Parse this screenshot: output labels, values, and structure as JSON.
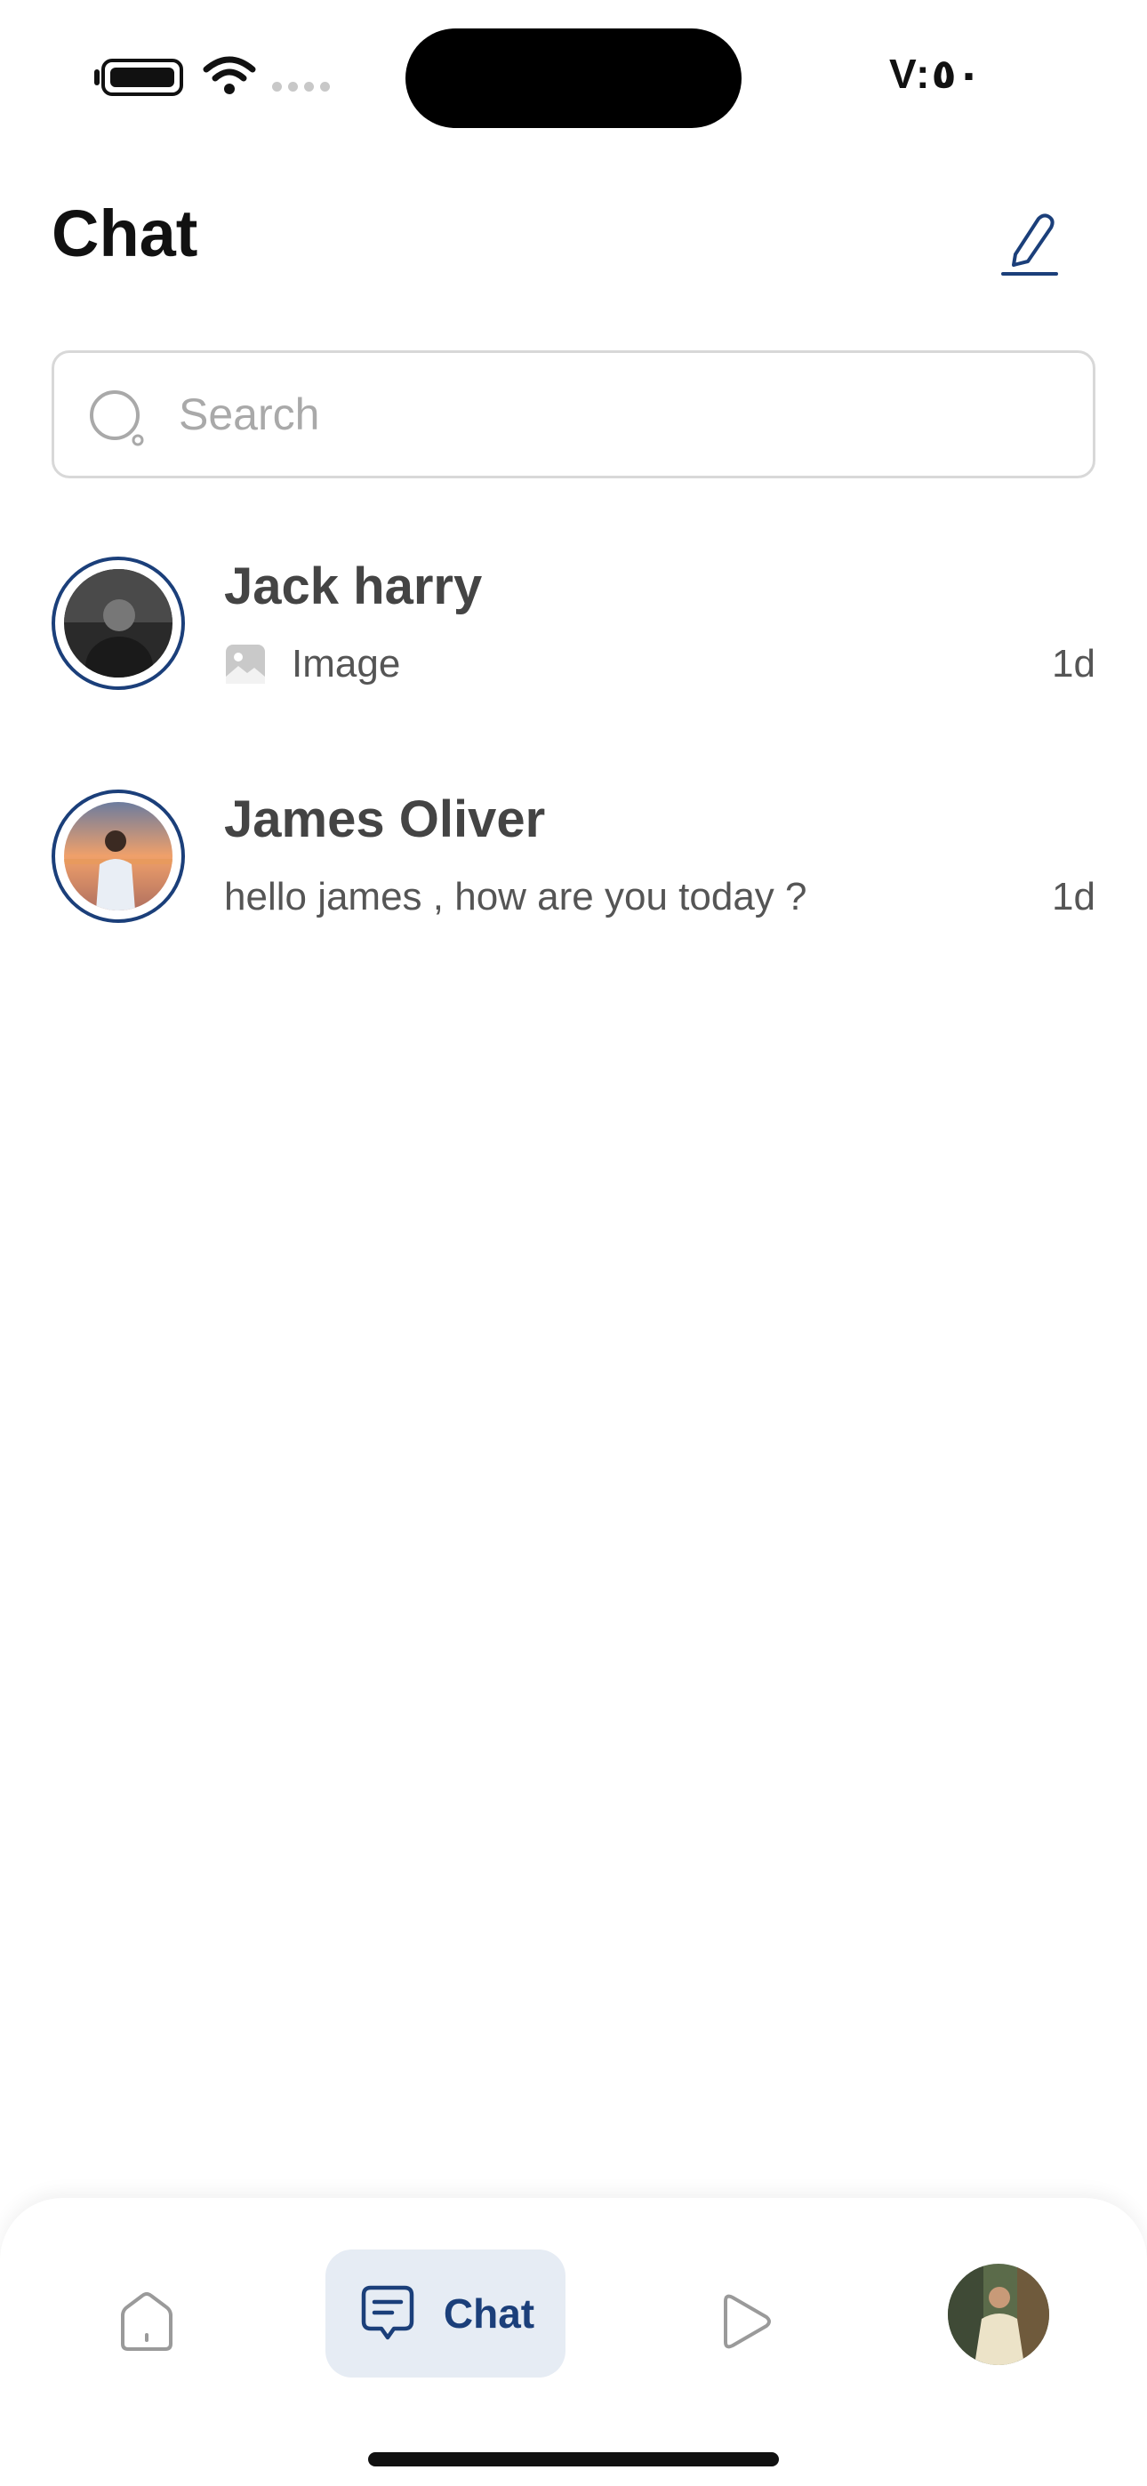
{
  "status_bar": {
    "time": "V:٥٠"
  },
  "header": {
    "title": "Chat",
    "compose_icon": "pencil-edit-icon"
  },
  "search": {
    "placeholder": "Search",
    "value": ""
  },
  "chats": [
    {
      "name": "Jack harry",
      "preview_icon": "image-icon",
      "preview": "Image",
      "time": "1d"
    },
    {
      "name": "James Oliver",
      "preview": "hello james , how are you today ?",
      "time": "1d"
    }
  ],
  "bottom_nav": {
    "items": [
      {
        "icon": "home-icon"
      },
      {
        "icon": "chat-icon",
        "label": "Chat",
        "active": true
      },
      {
        "icon": "play-icon"
      },
      {
        "icon": "profile-avatar"
      }
    ]
  },
  "colors": {
    "accent": "#1b3f7a",
    "active_tab_bg": "#e6ecf4",
    "text_secondary": "#555555"
  }
}
